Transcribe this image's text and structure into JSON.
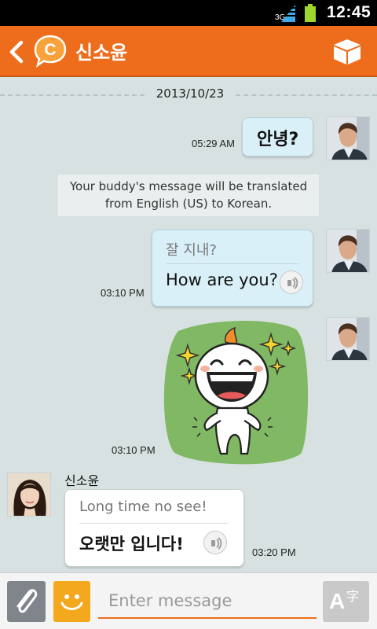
{
  "status_bar": {
    "network": "3G",
    "clock": "12:45",
    "signal_icon": "signal-icon",
    "battery_icon": "battery-icon",
    "battery_color": "#9fd62b"
  },
  "header": {
    "back_icon": "back-arrow-icon",
    "logo_icon": "chaton-logo-icon",
    "logo_letter": "C",
    "title": "신소윤",
    "menu_icon": "box-icon",
    "color": "#ed6d1d"
  },
  "date_divider": "2013/10/23",
  "messages": [
    {
      "type": "sent",
      "text": "안녕?",
      "time": "05:29 AM"
    },
    {
      "type": "notice",
      "line1": "Your buddy's message will be translated",
      "line2": "from English (US) to Korean."
    },
    {
      "type": "sent",
      "original": "잘 지내?",
      "translation": "How are you?",
      "time": "03:10 PM"
    },
    {
      "type": "sent-sticker",
      "sticker_icon": "laughing-character-sticker",
      "time": "03:10 PM"
    },
    {
      "type": "received",
      "sender": "신소윤",
      "original": "Long time no see!",
      "translation": "오랫만 입니다!",
      "time": "03:20 PM"
    }
  ],
  "input_bar": {
    "attach_icon": "paperclip-icon",
    "emoji_icon": "smiley-icon",
    "placeholder": "Enter message",
    "translate_icon": "translate-icon",
    "translate_letter": "A",
    "translate_char": "字"
  }
}
